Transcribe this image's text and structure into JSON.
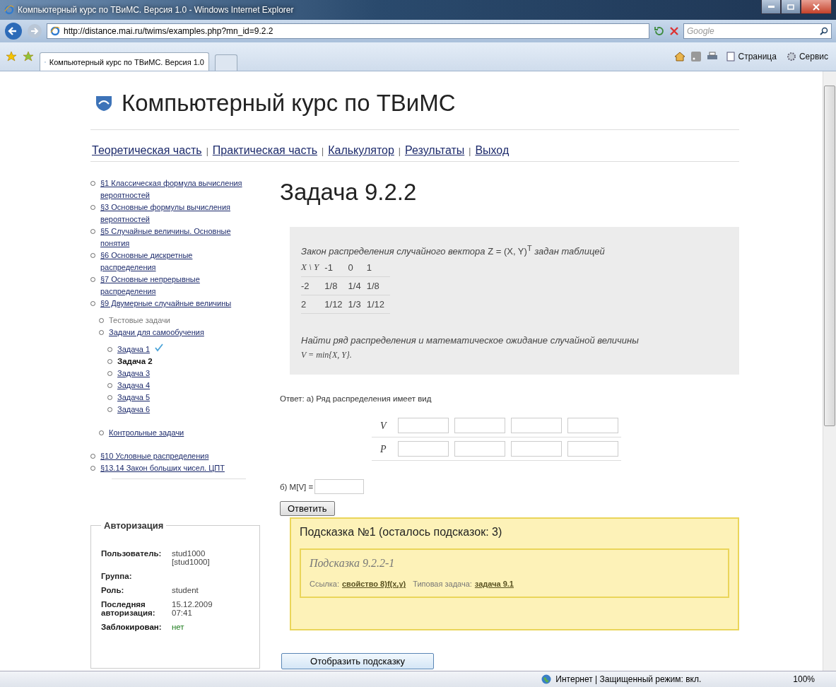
{
  "browser": {
    "title": "Компьютерный курс по ТВиМС. Версия 1.0 - Windows Internet Explorer",
    "url": "http://distance.mai.ru/twims/examples.php?mn_id=9.2.2",
    "search_placeholder": "Google",
    "tab_title": "Компьютерный курс по ТВиМС. Версия 1.0",
    "commands": [
      "Страница",
      "Сервис"
    ],
    "status": "Интернет | Защищенный режим: вкл.",
    "zoom": "100%"
  },
  "site": {
    "title": "Компьютерный курс по ТВиМС",
    "nav": [
      "Теоретическая часть",
      "Практическая часть",
      "Калькулятор",
      "Результаты",
      "Выход"
    ],
    "nav_separator": "|",
    "sidebar": [
      {
        "label": "§1 Классическая формула вычисления вероятностей",
        "kind": "link"
      },
      {
        "label": "§3 Основные формулы вычисления вероятностей",
        "kind": "link"
      },
      {
        "label": "§5 Случайные величины. Основные понятия",
        "kind": "link"
      },
      {
        "label": "§6 Основные дискретные распределения",
        "kind": "link"
      },
      {
        "label": "§7 Основные непрерывные распределения",
        "kind": "link"
      },
      {
        "label": "§9 Двумерные случайные величины",
        "kind": "link",
        "children": [
          {
            "label": "Тестовые задачи",
            "kind": "inactive"
          },
          {
            "label": "Задачи для самообучения",
            "kind": "link",
            "children": [
              {
                "label": "Задача 1",
                "kind": "link",
                "selected": false,
                "solved": true
              },
              {
                "label": "Задача 2",
                "kind": "link",
                "selected": true,
                "solved": false
              },
              {
                "label": "Задача 3",
                "kind": "link",
                "selected": false,
                "solved": false
              },
              {
                "label": "Задача 4",
                "kind": "link",
                "selected": false,
                "solved": false
              },
              {
                "label": "Задача 5",
                "kind": "link",
                "selected": false,
                "solved": false
              },
              {
                "label": "Задача 6",
                "kind": "link",
                "selected": false,
                "solved": false
              }
            ]
          },
          {
            "label": "Контрольные задачи",
            "kind": "link"
          }
        ]
      },
      {
        "label": "§10 Условные распределения",
        "kind": "link"
      },
      {
        "label": "§13.14 Закон больших чисел. ЦПТ",
        "kind": "link"
      }
    ],
    "auth": {
      "legend": "Авторизация",
      "rows": [
        {
          "label": "Пользователь:",
          "value": "stud1000 [stud1000]",
          "kind": "plain"
        },
        {
          "label": "Группа:",
          "kind": "plain"
        },
        {
          "label": "Роль:",
          "value": "student",
          "kind": "plain"
        },
        {
          "label": "Последняя авторизация:",
          "value": "15.12.2009 07:41",
          "kind": "plain"
        },
        {
          "label": "Заблокирован:",
          "value": "нет",
          "kind": "status"
        }
      ]
    },
    "heading": "Задача 9.2.2",
    "problem": {
      "statement": "*Закон распределения случайного вектора* Z = (X, Y)$^{T}$ *задан таблицей*",
      "table": {
        "columns": [
          "X \\ Y",
          "-1",
          "0",
          "1"
        ],
        "rows": [
          [
            "-2",
            "1/8",
            "1/4",
            "1/8"
          ],
          [
            "2",
            "1/12",
            "1/3",
            "1/12"
          ]
        ]
      },
      "question": "Найти ряд распределения и математическое ожидание случайной величины",
      "formula": "V = min{X, Y}."
    },
    "answer": {
      "label": "Ответ: а) Ряд распределения имеет вид",
      "rows": [
        {
          "label": "V"
        },
        {
          "label": "P"
        }
      ],
      "expectation_label": "б) M[V] =",
      "button": "Ответить"
    },
    "hint": {
      "title": "Подсказка №1 (осталось подсказок: 3)",
      "subtitle": "Подсказка 9.2.2-1",
      "link_label": "Ссылка:",
      "link": "свойство 8)f(x,y)",
      "typical_label": "Типовая задача:",
      "typical_link": "задача 9.1"
    },
    "show_hint_button": "Отобразить подсказку"
  }
}
